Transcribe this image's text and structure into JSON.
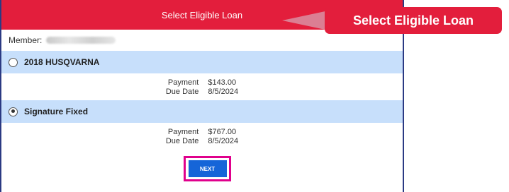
{
  "header": {
    "title": "Select Eligible Loan"
  },
  "member": {
    "label": "Member:"
  },
  "loans": [
    {
      "name": "2018 HUSQVARNA",
      "selected": false,
      "payment_label": "Payment",
      "payment_value": "$143.00",
      "due_label": "Due Date",
      "due_value": "8/5/2024"
    },
    {
      "name": "Signature Fixed",
      "selected": true,
      "payment_label": "Payment",
      "payment_value": "$767.00",
      "due_label": "Due Date",
      "due_value": "8/5/2024"
    }
  ],
  "actions": {
    "next_label": "NEXT"
  },
  "callout": {
    "text": "Select Eligible Loan"
  },
  "colors": {
    "title_bar": "#e31e3c",
    "loan_row_bg": "#c7dffb",
    "next_button": "#1565d8",
    "highlight_border": "#e0008c",
    "panel_border": "#2b3a83"
  }
}
